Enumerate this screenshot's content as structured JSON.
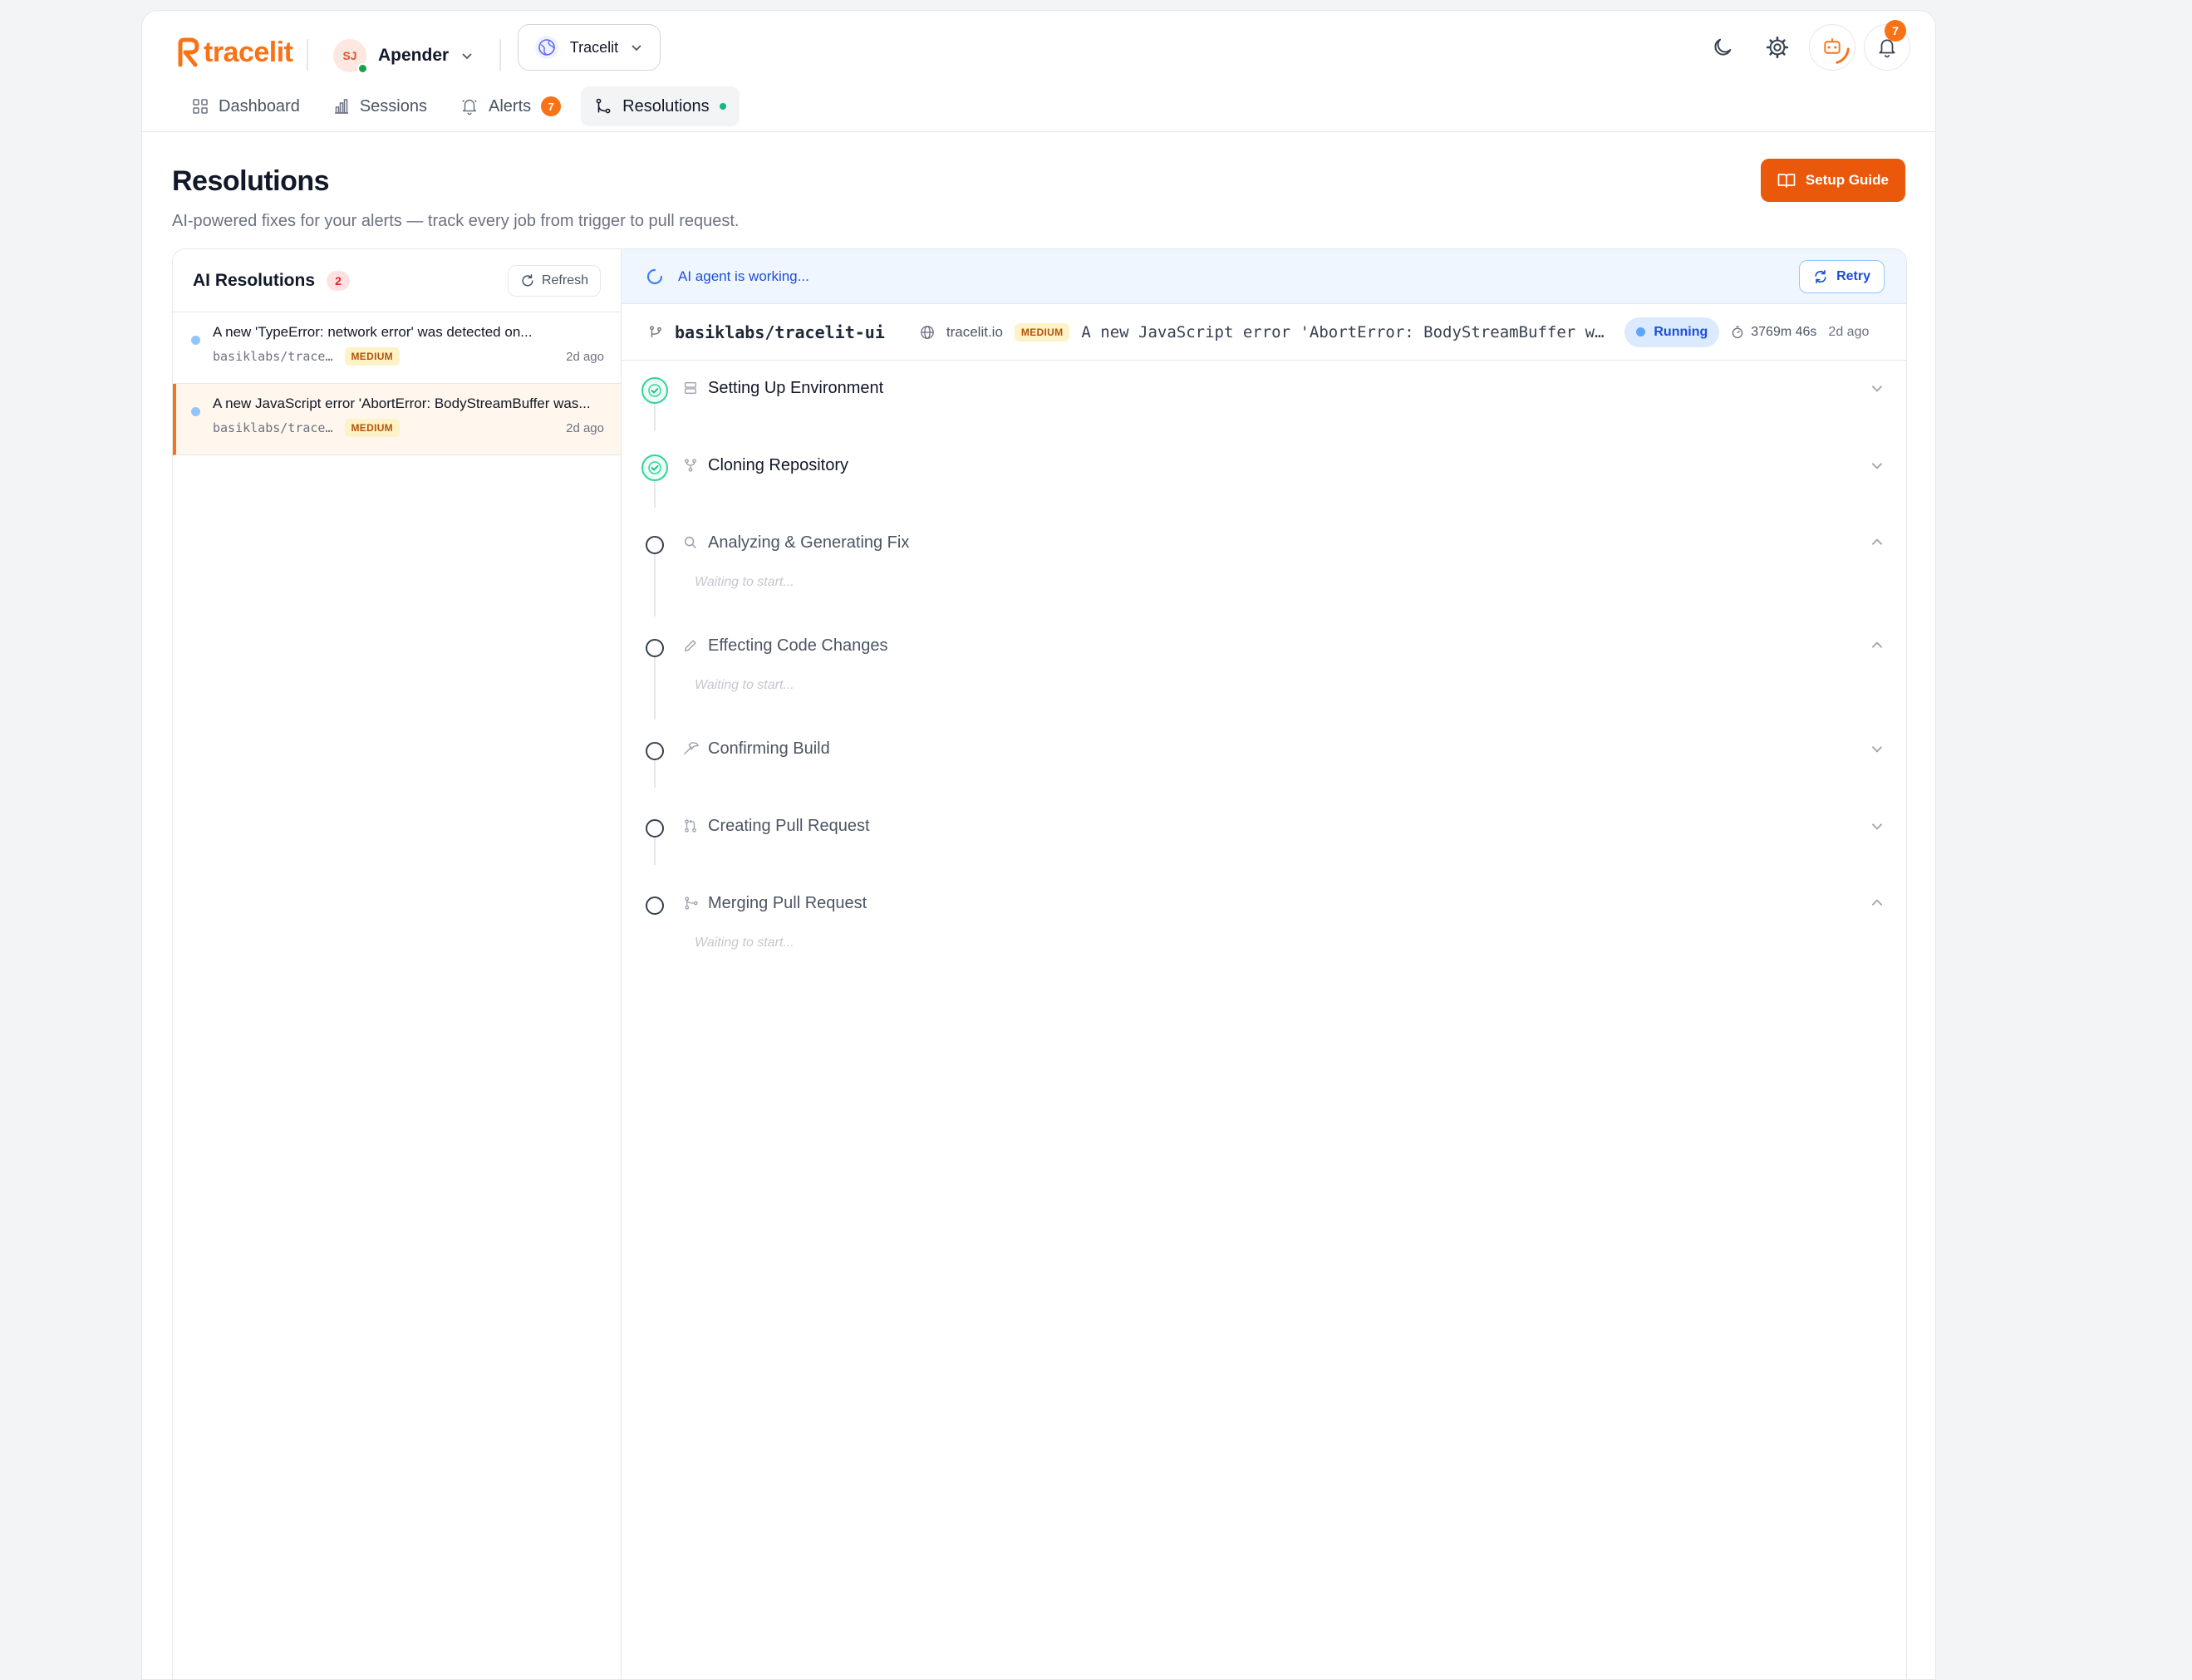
{
  "brand": {
    "name": "tracelit",
    "accent": "#f97316"
  },
  "workspace": {
    "initials": "SJ",
    "name": "Apender"
  },
  "project": {
    "name": "Tracelit"
  },
  "notifications": {
    "count": "7"
  },
  "nav": {
    "items": [
      {
        "label": "Dashboard",
        "icon": "grid-icon"
      },
      {
        "label": "Sessions",
        "icon": "bar-chart-icon"
      },
      {
        "label": "Alerts",
        "icon": "bell-icon",
        "badge": "7"
      },
      {
        "label": "Resolutions",
        "icon": "git-branch-icon",
        "active": true
      }
    ]
  },
  "page": {
    "title": "Resolutions",
    "subtitle": "AI-powered fixes for your alerts — track every job from trigger to pull request.",
    "setup_label": "Setup Guide"
  },
  "list": {
    "title": "AI Resolutions",
    "count": "2",
    "refresh_label": "Refresh",
    "items": [
      {
        "title": "A new 'TypeError: network error' was detected on...",
        "repo": "basiklabs/trace…",
        "severity": "MEDIUM",
        "time": "2d ago"
      },
      {
        "title": "A new JavaScript error 'AbortError: BodyStreamBuffer was...",
        "repo": "basiklabs/trace…",
        "severity": "MEDIUM",
        "time": "2d ago"
      }
    ]
  },
  "detail": {
    "agent_message": "AI agent is working...",
    "retry_label": "Retry",
    "repo": "basiklabs/tracelit-ui",
    "host": "tracelit.io",
    "severity": "MEDIUM",
    "title": "A new JavaScript error 'AbortError: BodyStreamBuffer was…",
    "status": "Running",
    "duration": "3769m 46s",
    "ago": "2d ago",
    "steps": [
      {
        "name": "Setting Up Environment",
        "status": "done",
        "icon": "server-icon"
      },
      {
        "name": "Cloning Repository",
        "status": "done",
        "icon": "git-fork-icon"
      },
      {
        "name": "Analyzing & Generating Fix",
        "status": "pending",
        "icon": "search-icon",
        "note": "Waiting to start..."
      },
      {
        "name": "Effecting Code Changes",
        "status": "pending",
        "icon": "pencil-icon",
        "note": "Waiting to start..."
      },
      {
        "name": "Confirming Build",
        "status": "pending",
        "icon": "hammer-icon"
      },
      {
        "name": "Creating Pull Request",
        "status": "pending",
        "icon": "git-pull-request-icon"
      },
      {
        "name": "Merging Pull Request",
        "status": "pending",
        "icon": "git-merge-icon",
        "note": "Waiting to start..."
      }
    ]
  }
}
